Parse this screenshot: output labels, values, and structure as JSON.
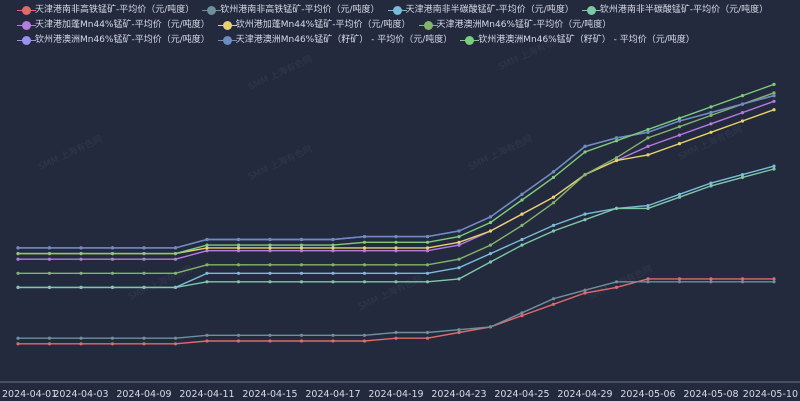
{
  "chart_data": {
    "type": "line",
    "x": [
      "2024-04-01",
      "2024-04-02",
      "2024-04-03",
      "2024-04-08",
      "2024-04-09",
      "2024-04-10",
      "2024-04-11",
      "2024-04-12",
      "2024-04-15",
      "2024-04-16",
      "2024-04-17",
      "2024-04-18",
      "2024-04-19",
      "2024-04-22",
      "2024-04-23",
      "2024-04-24",
      "2024-04-25",
      "2024-04-26",
      "2024-04-29",
      "2024-04-30",
      "2024-05-06",
      "2024-05-07",
      "2024-05-08",
      "2024-05-09",
      "2024-05-10"
    ],
    "xtick_labels": [
      "2024-04-01",
      "2024-04-03",
      "2024-04-09",
      "2024-04-11",
      "2024-04-15",
      "2024-04-17",
      "2024-04-19",
      "2024-04-23",
      "2024-04-25",
      "2024-04-29",
      "2024-05-06",
      "2024-05-08",
      "2024-05-10"
    ],
    "ylim": [
      0,
      100
    ],
    "grid": false,
    "legend_position": "top",
    "watermark": "SMM 上海有色网",
    "series": [
      {
        "name": "天津港南非高铁锰矿-平均价（元/吨度）",
        "color": "#e06b6b",
        "values": [
          10,
          10,
          10,
          10,
          10,
          10,
          11,
          11,
          11,
          11,
          11,
          11,
          12,
          12,
          14,
          16,
          20,
          24,
          28,
          30,
          33,
          33,
          33,
          33,
          33
        ]
      },
      {
        "name": "钦州港南非高铁锰矿-平均价（元/吨度）",
        "color": "#6f8f9c",
        "values": [
          12,
          12,
          12,
          12,
          12,
          12,
          13,
          13,
          13,
          13,
          13,
          13,
          14,
          14,
          15,
          16,
          21,
          26,
          29,
          32,
          32,
          32,
          32,
          32,
          32
        ]
      },
      {
        "name": "天津港南非半碳酸锰矿-平均价（元/吨度）",
        "color": "#78bcd8",
        "values": [
          30,
          30,
          30,
          30,
          30,
          30,
          35,
          35,
          35,
          35,
          35,
          35,
          35,
          35,
          37,
          42,
          47,
          52,
          56,
          58,
          59,
          63,
          67,
          70,
          73
        ]
      },
      {
        "name": "钦州港南非半碳酸锰矿-平均价（元/吨度）",
        "color": "#7fc8a6",
        "values": [
          30,
          30,
          30,
          30,
          30,
          30,
          32,
          32,
          32,
          32,
          32,
          32,
          32,
          32,
          33,
          39,
          45,
          50,
          54,
          58,
          58,
          62,
          66,
          69,
          72
        ]
      },
      {
        "name": "天津港加蓬Mn44%锰矿-平均价（元/吨度）",
        "color": "#b57be0",
        "values": [
          40,
          40,
          40,
          40,
          40,
          40,
          43,
          43,
          43,
          43,
          43,
          43,
          43,
          43,
          45,
          50,
          56,
          62,
          70,
          75,
          80,
          84,
          88,
          92,
          96
        ]
      },
      {
        "name": "钦州港加蓬Mn44%锰矿-平均价（元/吨度）",
        "color": "#e8d26a",
        "values": [
          42,
          42,
          42,
          42,
          42,
          42,
          44,
          44,
          44,
          44,
          44,
          44,
          44,
          44,
          46,
          50,
          56,
          62,
          70,
          75,
          77,
          81,
          85,
          89,
          93
        ]
      },
      {
        "name": "天津港澳洲Mn46%锰矿-平均价（元/吨度）",
        "color": "#84b46a",
        "values": [
          35,
          35,
          35,
          35,
          35,
          35,
          38,
          38,
          38,
          38,
          38,
          38,
          38,
          38,
          40,
          45,
          52,
          60,
          70,
          76,
          83,
          87,
          91,
          95,
          99
        ]
      },
      {
        "name": "钦州港澳洲Mn46%锰矿-平均价（元/吨度）",
        "color": "#9a90ee",
        "values": [
          44,
          44,
          44,
          44,
          44,
          44,
          47,
          47,
          47,
          47,
          47,
          48,
          48,
          48,
          50,
          55,
          63,
          71,
          80,
          83,
          85,
          89,
          92,
          95,
          98
        ]
      },
      {
        "name": "天津港澳洲Mn46%锰矿（籽矿） - 平均价（元/吨度）",
        "color": "#6e8cc0",
        "values": [
          44,
          44,
          44,
          44,
          44,
          44,
          47,
          47,
          47,
          47,
          47,
          48,
          48,
          48,
          50,
          55,
          63,
          71,
          80,
          83,
          85,
          89,
          92,
          95,
          98
        ]
      },
      {
        "name": "钦州港澳洲Mn46%锰矿（籽矿） - 平均价（元/吨度）",
        "color": "#7ccd7c",
        "values": [
          42,
          42,
          42,
          42,
          42,
          42,
          45,
          45,
          45,
          45,
          45,
          46,
          46,
          46,
          48,
          53,
          61,
          69,
          78,
          82,
          86,
          90,
          94,
          98,
          102
        ]
      }
    ]
  }
}
